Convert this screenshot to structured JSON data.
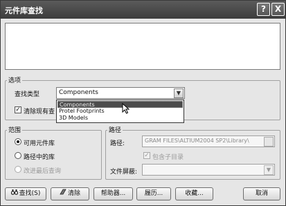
{
  "window": {
    "title": "元件库查找",
    "help_label": "?",
    "close_label": "X"
  },
  "options": {
    "group_label": "选项",
    "find_type_label": "查找类型",
    "find_type_value": "Components",
    "dropdown_items": [
      "Components",
      "Protel Footprints",
      "3D Models"
    ],
    "dropdown_selected_index": 0,
    "clear_existing_label": "清除现有查",
    "clear_existing_checked": true,
    "combo_arrow": "▼"
  },
  "scope": {
    "group_label": "范围",
    "options": [
      {
        "label": "可用元件库",
        "checked": true,
        "disabled": false
      },
      {
        "label": "路径中的库",
        "checked": false,
        "disabled": false
      },
      {
        "label": "改进最后查询",
        "checked": false,
        "disabled": true
      }
    ]
  },
  "path": {
    "group_label": "路径",
    "path_label": "路径:",
    "path_value": "GRAM FILES\\ALTIUM2004 SP2\\Library\\",
    "include_subdirs_label": "包含子目录",
    "include_subdirs_checked": true,
    "file_mask_label": "文件屏蔽:"
  },
  "buttons": {
    "search": "查找(S)",
    "clear": "清除",
    "helper": "帮助器...",
    "history": "履历...",
    "favorites": "收藏...",
    "cancel": "取消"
  },
  "icons": {
    "search": "binoculars-icon",
    "clear": "eraser-icon",
    "checkmark": "✓"
  },
  "colors": {
    "titlebar": "#4a4a4a",
    "dialog_bg": "#e6e6e6",
    "selected_item": "#4c4c4c"
  }
}
